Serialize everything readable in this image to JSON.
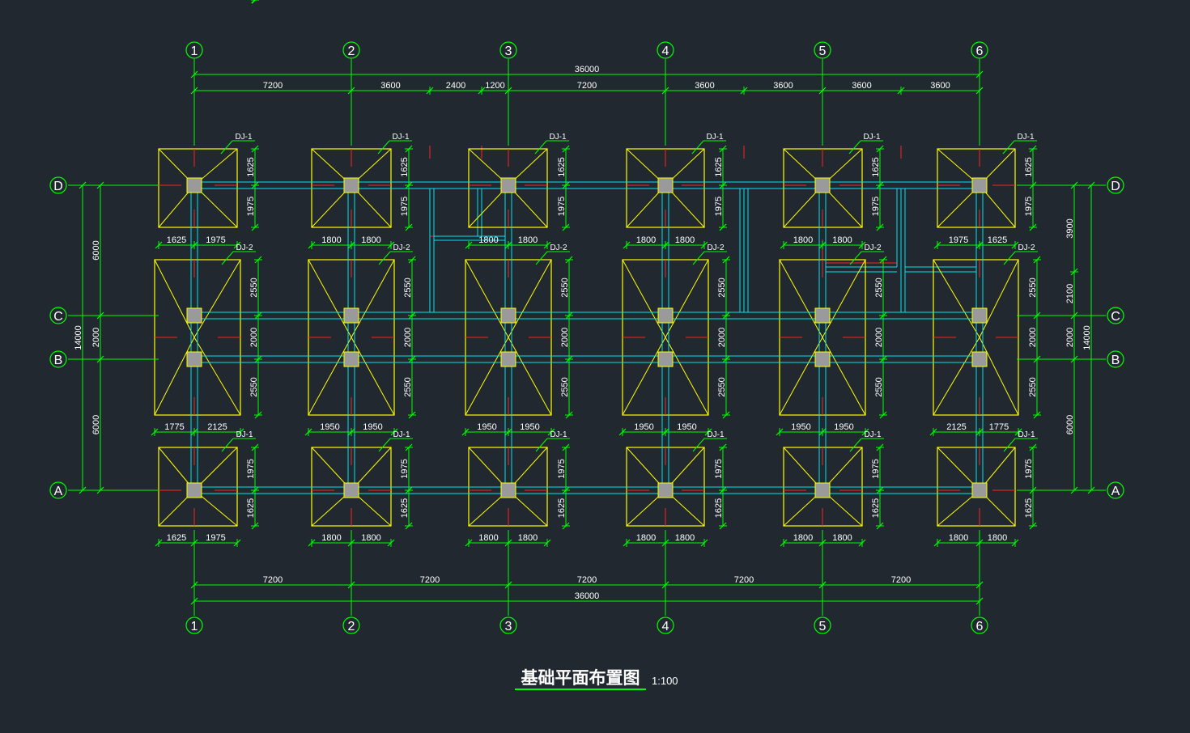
{
  "title": {
    "text": "基础平面布置图",
    "scale": "1:100"
  },
  "grid": {
    "columns": [
      "1",
      "2",
      "3",
      "4",
      "5",
      "6"
    ],
    "rows": [
      "D",
      "C",
      "B",
      "A"
    ]
  },
  "dimensions": {
    "top_total": "36000",
    "top_segments": [
      "7200",
      "3600",
      "2400",
      "1200",
      "7200",
      "3600",
      "3600",
      "3600",
      "3600"
    ],
    "bottom_segments": [
      "7200",
      "7200",
      "7200",
      "7200",
      "7200"
    ],
    "bottom_total": "36000",
    "left_outer": "14000",
    "left_segments": [
      "6000",
      "2000",
      "6000"
    ],
    "right_segments": [
      "3900",
      "2100",
      "2000",
      "6000"
    ],
    "right_outer": "14000"
  },
  "footings": {
    "dj1_label": "DJ-1",
    "dj2_label": "DJ-2",
    "top_row": {
      "vert": [
        "1625",
        "1975"
      ],
      "horiz": [
        [
          "1625",
          "1975"
        ],
        [
          "1800",
          "1800"
        ],
        [
          "1800",
          "1800"
        ],
        [
          "1800",
          "1800"
        ],
        [
          "1800",
          "1800"
        ],
        [
          "1975",
          "1625"
        ]
      ]
    },
    "middle_row": {
      "vert": [
        "2550",
        "2000",
        "2550"
      ],
      "horiz": [
        [
          "1775",
          "2125"
        ],
        [
          "1950",
          "1950"
        ],
        [
          "1950",
          "1950"
        ],
        [
          "1950",
          "1950"
        ],
        [
          "1950",
          "1950"
        ],
        [
          "2125",
          "1775"
        ]
      ]
    },
    "bottom_row": {
      "vert": [
        "1975",
        "1625"
      ],
      "horiz": [
        [
          "1625",
          "1975"
        ],
        [
          "1800",
          "1800"
        ],
        [
          "1800",
          "1800"
        ],
        [
          "1800",
          "1800"
        ],
        [
          "1800",
          "1800"
        ],
        [
          "1800",
          "1800"
        ]
      ]
    }
  },
  "colors": {
    "background": "#212830",
    "axis": "#00ff00",
    "footing": "#ffff00",
    "beam": "#00e5ee",
    "center_line": "#ff2020",
    "column": "#9a9a9a",
    "text": "#ffffff"
  }
}
